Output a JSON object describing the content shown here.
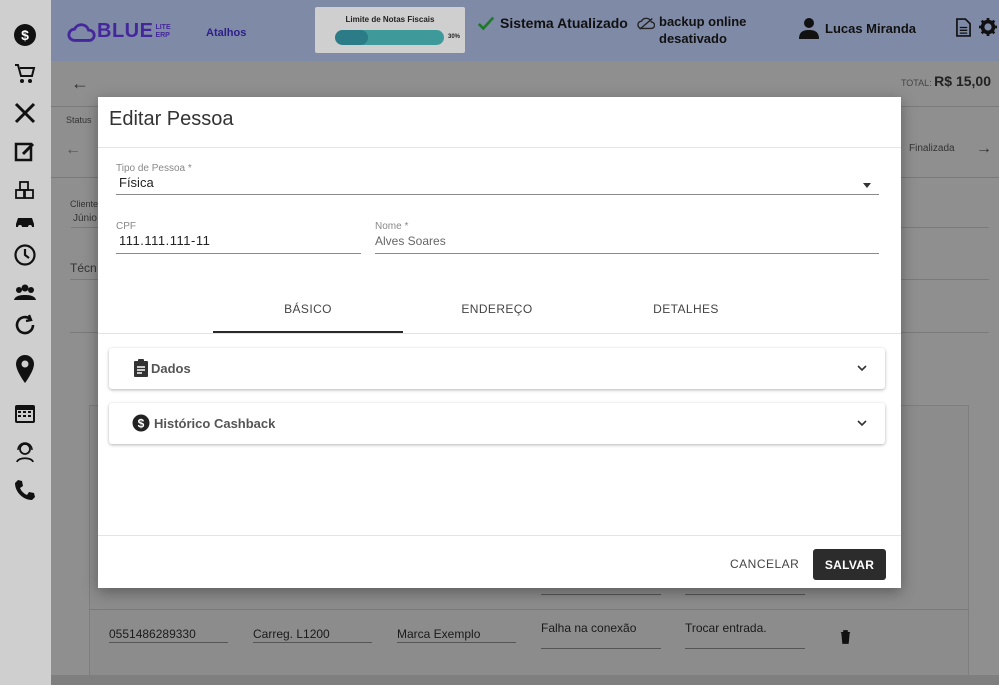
{
  "header": {
    "logo_text": "BLUE",
    "logo_sub_top": "LITE",
    "logo_sub_bottom": "ERP",
    "shortcuts_label": "Atalhos",
    "invoice_limit": {
      "title": "Limite de Notas Fiscais",
      "percent_label": "30%",
      "percent": 0.3
    },
    "system_status": "Sistema Atualizado",
    "backup_status": "backup online desativado",
    "user_name": "Lucas Miranda"
  },
  "sidebar": {
    "items": [
      {
        "icon": "dollar-icon"
      },
      {
        "icon": "cart-icon"
      },
      {
        "icon": "tools-icon"
      },
      {
        "icon": "edit-icon"
      },
      {
        "icon": "boxes-icon"
      },
      {
        "icon": "car-icon"
      },
      {
        "icon": "clock-icon"
      },
      {
        "icon": "users-icon"
      },
      {
        "icon": "sync-icon"
      },
      {
        "icon": "map-pin-icon"
      },
      {
        "icon": "calendar-icon"
      },
      {
        "icon": "support-agent-icon"
      },
      {
        "icon": "phone-icon"
      }
    ]
  },
  "page": {
    "total_label": "TOTAL:",
    "total_value": "R$ 15,00",
    "status_label": "Status",
    "finalized_label": "Finalizada",
    "client_label": "Cliente",
    "client_value": "Júnio",
    "technician_label": "Técn",
    "table_row": {
      "serial": "0551486289330",
      "model": "Carreg. L1200",
      "brand": "Marca Exemplo",
      "problem": "Falha na conexão",
      "solution": "Trocar entrada."
    }
  },
  "modal": {
    "title": "Editar Pessoa",
    "person_type": {
      "label": "Tipo de Pessoa *",
      "value": "Física"
    },
    "cpf": {
      "label": "CPF",
      "value": "111.111.111-11"
    },
    "name": {
      "label": "Nome *",
      "value": "Alves Soares"
    },
    "tabs": [
      {
        "label": "BÁSICO",
        "active": true
      },
      {
        "label": "ENDEREÇO",
        "active": false
      },
      {
        "label": "DETALHES",
        "active": false
      }
    ],
    "panels": [
      {
        "label": "Dados",
        "icon": "clipboard-icon"
      },
      {
        "label": "Histórico Cashback",
        "icon": "dollar-circle-icon"
      }
    ],
    "cancel_label": "CANCELAR",
    "save_label": "SALVAR"
  },
  "colors": {
    "topbar": "#7f8aa6",
    "sidebar": "#cfcfcf",
    "overlay_bg": "#8f8f8f",
    "brand_purple": "#45279c",
    "progress": "#3e9a9a",
    "save_button": "#2c2c2c"
  }
}
